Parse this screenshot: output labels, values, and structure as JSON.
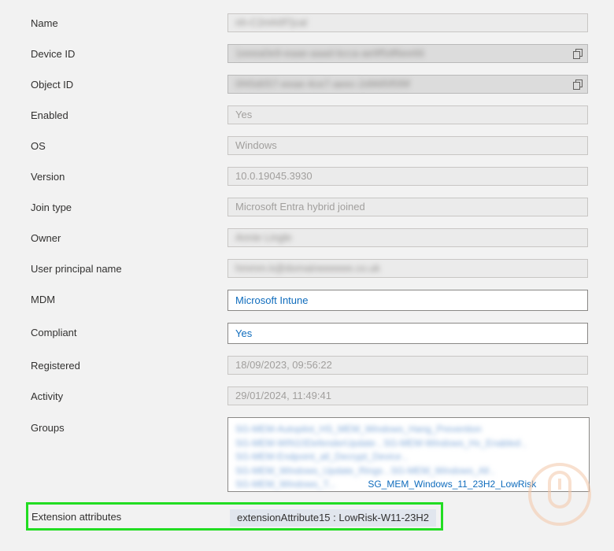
{
  "properties": {
    "name": {
      "label": "Name",
      "value": "nh-C2mh0f7jcal"
    },
    "device_id": {
      "label": "Device ID",
      "value": "1eeea0e9-eaae-aaad-bcca-ae9f5df6ee66"
    },
    "object_id": {
      "label": "Object ID",
      "value": "0f45d057-eeae-4ce7-aeec-2d96f0f5f9f"
    },
    "enabled": {
      "label": "Enabled",
      "value": "Yes"
    },
    "os": {
      "label": "OS",
      "value": "Windows"
    },
    "version": {
      "label": "Version",
      "value": "10.0.19045.3930"
    },
    "join_type": {
      "label": "Join type",
      "value": "Microsoft Entra hybrid joined"
    },
    "owner": {
      "label": "Owner",
      "value": "Annie Lingle"
    },
    "upn": {
      "label": "User principal name",
      "value": "hmmm.k@domaineeeeee.co.uk"
    },
    "mdm": {
      "label": "MDM",
      "value": "Microsoft Intune"
    },
    "compliant": {
      "label": "Compliant",
      "value": "Yes"
    },
    "registered": {
      "label": "Registered",
      "value": "18/09/2023, 09:56:22"
    },
    "activity": {
      "label": "Activity",
      "value": "29/01/2024, 11:49:41"
    }
  },
  "groups": {
    "label": "Groups",
    "lines": [
      "SG-MEM-Autopilot_HS_MEM_Windows_Hang_Prevention",
      "SG-MEM-WIN10DefenderUpdate , SG-MEM-Windows_Hv_Enabled ,",
      "SG-MEM-Endpoint_all_Decrypt_Device ,",
      "SG-MEM_Windows_Update_Rings , SG-MEM_Windows_All ,",
      "SG-MEM_Windows_T..."
    ],
    "visible_link": "SG_MEM_Windows_11_23H2_LowRisk"
  },
  "extension": {
    "label": "Extension attributes",
    "value": "extensionAttribute15 : LowRisk-W11-23H2"
  }
}
